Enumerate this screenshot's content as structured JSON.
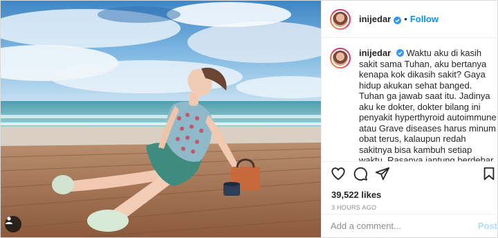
{
  "header": {
    "username": "inijedar",
    "separator": "•",
    "follow_label": "Follow"
  },
  "caption": {
    "username": "inijedar",
    "text": "Waktu aku di kasih sakit sama Tuhan, aku bertanya kenapa kok dikasih sakit? Gaya hidup akukan sehat banged. Tuhan ga jawab saat itu. Jadinya aku ke dokter, dokter bilang ini penyakit hyperthyroid autoimmune atau Grave diseases harus minum obat terus, kalaupun redah sakitnya bisa kambuh setiap waktu. Rasanya jantung berdebar, lemas, sakit kepala, insomnia, emosional mudah marah dan jadi"
  },
  "actions": {
    "like_icon": "heart-icon",
    "comment_icon": "comment-icon",
    "share_icon": "paper-plane-icon",
    "save_icon": "bookmark-icon"
  },
  "likes_text": "39,522 likes",
  "time_text": "3 HOURS AGO",
  "comment_box": {
    "placeholder": "Add a comment...",
    "post_label": "Post"
  },
  "colors": {
    "link_blue": "#0095f6",
    "post_disabled": "#b3dbff",
    "muted_text": "#8e8e8e"
  }
}
